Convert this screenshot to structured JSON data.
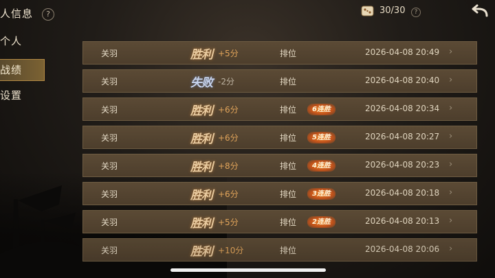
{
  "header": {
    "title": "人信息",
    "help": "?",
    "count": "30/30",
    "count_help": "?"
  },
  "sidebar": {
    "items": [
      {
        "label": "个人",
        "active": false
      },
      {
        "label": "战绩",
        "active": true
      },
      {
        "label": "设置",
        "active": false
      }
    ]
  },
  "records": [
    {
      "name": "关羽",
      "result": "胜利",
      "score": "+5分",
      "mode": "排位",
      "streak": "",
      "time": "2026-04-08 20:49",
      "win": true
    },
    {
      "name": "关羽",
      "result": "失败",
      "score": "-2分",
      "mode": "排位",
      "streak": "",
      "time": "2026-04-08 20:40",
      "win": false
    },
    {
      "name": "关羽",
      "result": "胜利",
      "score": "+6分",
      "mode": "排位",
      "streak": "6连胜",
      "time": "2026-04-08 20:34",
      "win": true
    },
    {
      "name": "关羽",
      "result": "胜利",
      "score": "+6分",
      "mode": "排位",
      "streak": "5连胜",
      "time": "2026-04-08 20:27",
      "win": true
    },
    {
      "name": "关羽",
      "result": "胜利",
      "score": "+8分",
      "mode": "排位",
      "streak": "4连胜",
      "time": "2026-04-08 20:23",
      "win": true
    },
    {
      "name": "关羽",
      "result": "胜利",
      "score": "+6分",
      "mode": "排位",
      "streak": "3连胜",
      "time": "2026-04-08 20:18",
      "win": true
    },
    {
      "name": "关羽",
      "result": "胜利",
      "score": "+5分",
      "mode": "排位",
      "streak": "2连胜",
      "time": "2026-04-08 20:13",
      "win": true
    },
    {
      "name": "关羽",
      "result": "胜利",
      "score": "+10分",
      "mode": "排位",
      "streak": "",
      "time": "2026-04-08 20:06",
      "win": true
    }
  ],
  "colors": {
    "row_bg": "#5b4a35",
    "win_score": "#e1a45a",
    "streak": "#f08a2a",
    "active_tab": "#7b6233"
  }
}
